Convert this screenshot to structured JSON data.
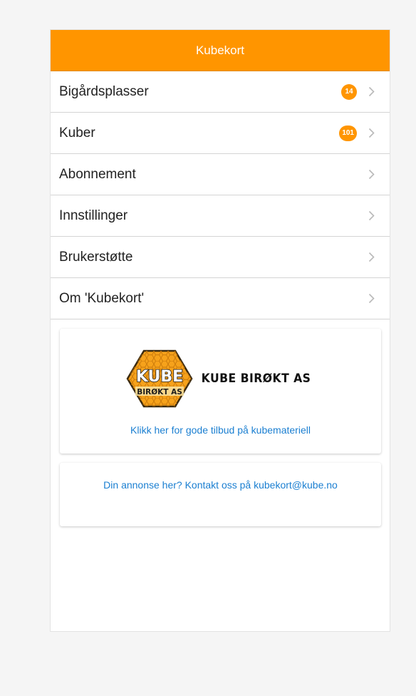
{
  "header": {
    "title": "Kubekort"
  },
  "menu": {
    "items": [
      {
        "label": "Bigårdsplasser",
        "badge": "14"
      },
      {
        "label": "Kuber",
        "badge": "101"
      },
      {
        "label": "Abonnement"
      },
      {
        "label": "Innstillinger"
      },
      {
        "label": "Brukerstøtte"
      },
      {
        "label": "Om 'Kubekort'"
      }
    ]
  },
  "ad": {
    "logo_badge_top": "KUBE",
    "logo_badge_bottom": "BIRØKT AS",
    "logo_text": "KUBE BIRØKT AS",
    "link": "Klikk her for gode tilbud på kubemateriell"
  },
  "contact": {
    "link": "Din annonse her? Kontakt oss på kubekort@kube.no"
  },
  "colors": {
    "accent": "#ff9500",
    "link": "#1b7fd1",
    "chevron": "#b9b9b9"
  },
  "icons": {
    "chevron": "chevron-right-icon",
    "logo": "honeycomb-hexagon-logo"
  }
}
